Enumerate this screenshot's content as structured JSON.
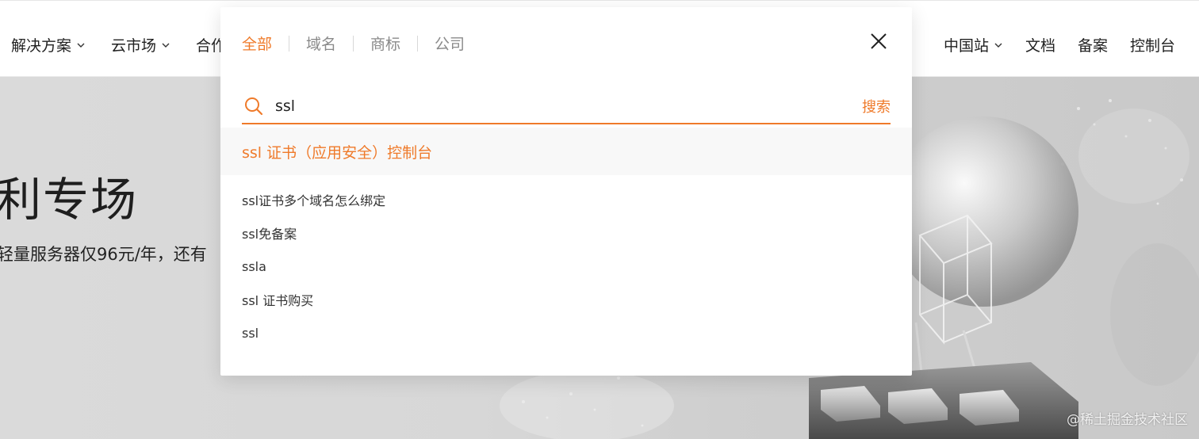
{
  "nav": {
    "left": [
      {
        "label": "解决方案",
        "icon": "chevron-down-icon"
      },
      {
        "label": "云市场",
        "icon": "chevron-down-icon"
      },
      {
        "label": "合作"
      }
    ],
    "right": [
      {
        "label": "中国站",
        "icon": "chevron-down-icon"
      },
      {
        "label": "文档"
      },
      {
        "label": "备案"
      },
      {
        "label": "控制台"
      }
    ]
  },
  "hero": {
    "title": "利专场",
    "subtitle": "轻量服务器仅96元/年，还有"
  },
  "search": {
    "tabs": [
      "全部",
      "域名",
      "商标",
      "公司"
    ],
    "active_tab": "全部",
    "query": "ssl",
    "search_button": "搜索",
    "top_suggestion": "ssl 证书（应用安全）控制台",
    "suggestions": [
      "ssl证书多个域名怎么绑定",
      "ssl免备案",
      "ssla",
      "ssl 证书购买",
      "ssl"
    ]
  },
  "watermark": "@稀土掘金技术社区",
  "colors": {
    "accent": "#ef7a2a",
    "nav_text": "#222222",
    "tab_inactive": "#8a8a8a",
    "suggest_highlight_bg": "#f8f8f8"
  }
}
